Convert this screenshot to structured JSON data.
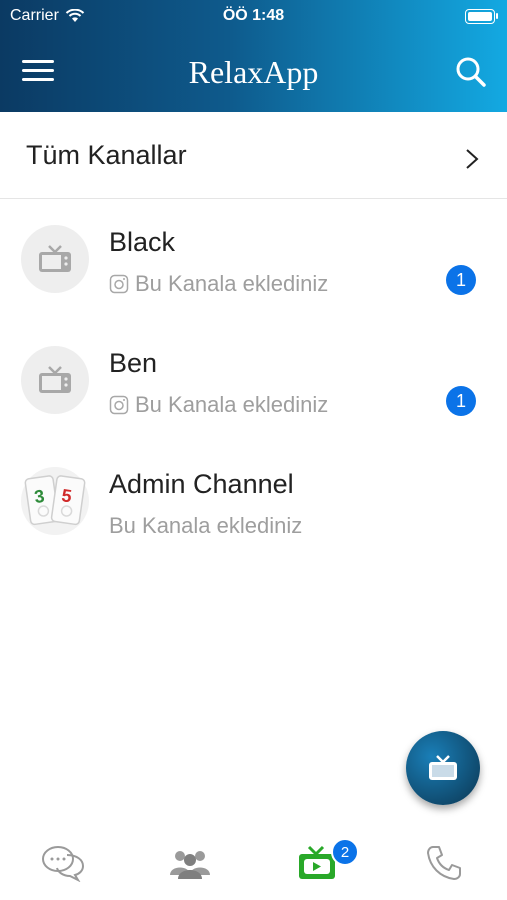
{
  "status_bar": {
    "carrier": "Carrier",
    "time": "ÖÖ 1:48"
  },
  "header": {
    "title": "RelaxApp"
  },
  "all_channels": {
    "label": "Tüm Kanallar"
  },
  "channels": [
    {
      "name": "Black",
      "subtitle": "Bu Kanala eklediniz",
      "unread": "1"
    },
    {
      "name": "Ben",
      "subtitle": "Bu Kanala eklediniz",
      "unread": "1"
    },
    {
      "name": "Admin Channel",
      "subtitle": "Bu Kanala eklediniz",
      "avatar_digits": [
        "3",
        "5"
      ]
    }
  ],
  "tabbar": {
    "items": [
      "chat-icon",
      "groups-icon",
      "channels-icon",
      "phone-icon"
    ],
    "active": "channels-icon",
    "channels_badge": "2"
  },
  "colors": {
    "accent": "#0b73e8",
    "header_start": "#0b3a63",
    "header_end": "#13a9e2",
    "active_tab": "#29a829"
  }
}
